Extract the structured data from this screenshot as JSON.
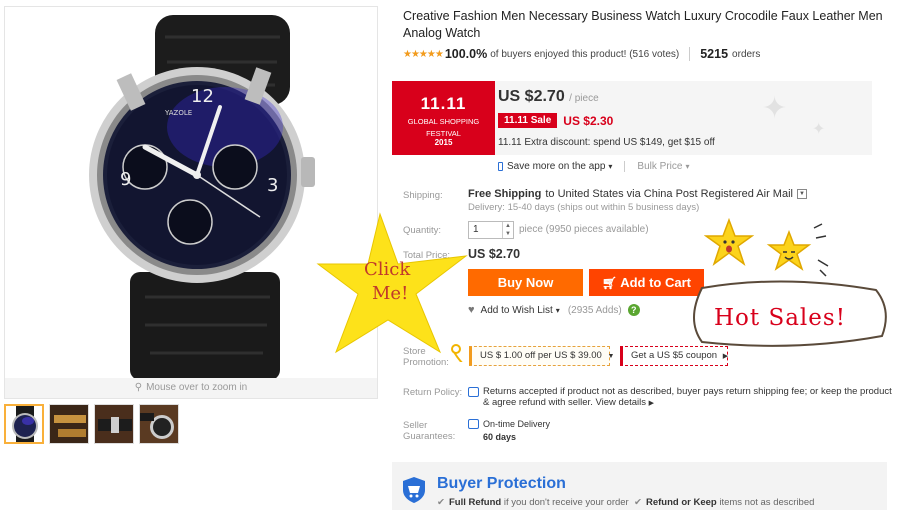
{
  "product": {
    "title": "Creative Fashion Men Necessary Business Watch Luxury Crocodile Faux Leather Men Analog Watch",
    "rating_stars": "★★★★★",
    "rating_pct": "100.0%",
    "rating_text": "of buyers enjoyed this product! (516 votes)",
    "orders_count": "5215",
    "orders_label": "orders"
  },
  "image": {
    "zoom_hint": "Mouse over to zoom in",
    "watch_brand": "YAZOLE",
    "thumbnails": [
      "thumb-watch-front",
      "thumb-watch-strap",
      "thumb-watch-side",
      "thumb-watch-back"
    ]
  },
  "promo": {
    "festival_big": "11.11",
    "festival_line1": "GLOBAL SHOPPING",
    "festival_line2": "FESTIVAL",
    "festival_year": "2015",
    "price": "US $2.70",
    "price_unit": "/ piece",
    "sale_badge": "11.11 Sale",
    "sale_price": "US $2.30",
    "extra_discount": "11.11 Extra discount: spend US $149, get $15 off",
    "save_app": "Save more on the app",
    "bulk_price": "Bulk Price"
  },
  "shipping": {
    "label": "Shipping:",
    "free": "Free Shipping",
    "to": "to United States via China Post Registered Air Mail",
    "delivery": "Delivery: 15-40 days (ships out within 5 business days)"
  },
  "quantity": {
    "label": "Quantity:",
    "value": "1",
    "pieces": "piece (9950 pieces available)"
  },
  "total": {
    "label": "Total Price:",
    "value": "US $2.70"
  },
  "actions": {
    "buy_now": "Buy Now",
    "add_to_cart": "Add to Cart",
    "wish_list": "Add to Wish List",
    "wish_count": "(2935 Adds)",
    "help": "?"
  },
  "store_promotion": {
    "label_line1": "Store",
    "label_line2": "Promotion:",
    "coupon": "US $ 1.00 off per US $ 39.00",
    "get_coupon": "Get a US $5 coupon"
  },
  "return_policy": {
    "label": "Return Policy:",
    "text": "Returns accepted if product not as described, buyer pays return shipping fee; or keep the product & agree refund with seller.",
    "view_details": "View details"
  },
  "guarantees": {
    "label_line1": "Seller",
    "label_line2": "Guarantees:",
    "on_time": "On-time Delivery",
    "days": "60 days"
  },
  "buyer_protection": {
    "title": "Buyer Protection",
    "full_refund": "Full Refund",
    "full_refund_rest": "if you don't receive your order",
    "refund_keep": "Refund or Keep",
    "refund_keep_rest": "items not as described"
  },
  "overlays": {
    "click_line1": "Click",
    "click_line2": "Me!",
    "hot_sales": "Hot  Sales!"
  },
  "colors": {
    "accent_red": "#d8001b",
    "buy_orange": "#ff6a00",
    "cart_orange": "#ff4400",
    "star_yellow": "#fde21a",
    "link_blue": "#2a6fd6"
  }
}
